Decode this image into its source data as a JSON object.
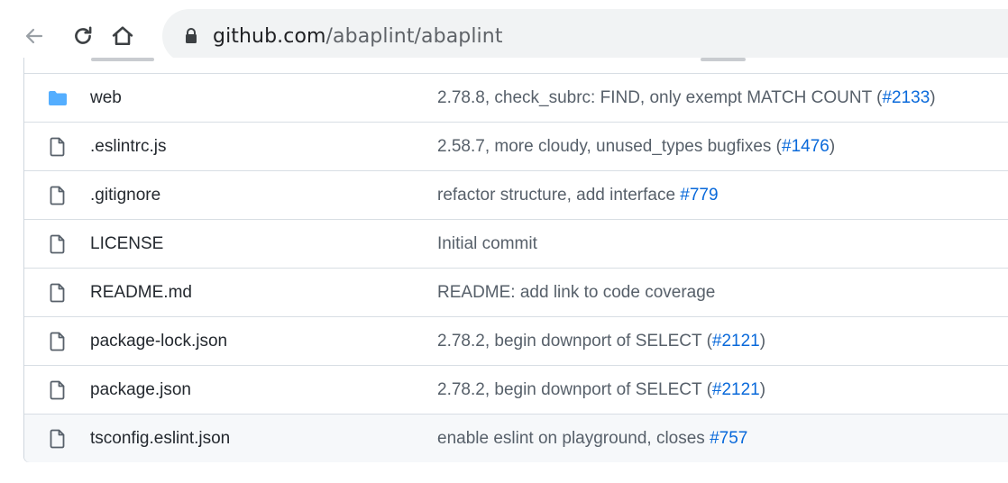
{
  "browser": {
    "url_host": "github.com",
    "url_path": "/abaplint/abaplint",
    "icons": {
      "back": "arrow-left",
      "reload": "reload",
      "home": "home",
      "lock": "lock"
    }
  },
  "files": [
    {
      "name": "web",
      "type": "folder",
      "msg_before": "2.78.8, check_subrc: FIND, only exempt MATCH COUNT (",
      "link": "#2133",
      "msg_after": ")"
    },
    {
      "name": ".eslintrc.js",
      "type": "file",
      "msg_before": "2.58.7, more cloudy, unused_types bugfixes (",
      "link": "#1476",
      "msg_after": ")"
    },
    {
      "name": ".gitignore",
      "type": "file",
      "msg_before": "refactor structure, add interface ",
      "link": "#779",
      "msg_after": ""
    },
    {
      "name": "LICENSE",
      "type": "file",
      "msg_before": "Initial commit",
      "link": "",
      "msg_after": ""
    },
    {
      "name": "README.md",
      "type": "file",
      "msg_before": "README: add link to code coverage",
      "link": "",
      "msg_after": ""
    },
    {
      "name": "package-lock.json",
      "type": "file",
      "msg_before": "2.78.2, begin downport of SELECT (",
      "link": "#2121",
      "msg_after": ")"
    },
    {
      "name": "package.json",
      "type": "file",
      "msg_before": "2.78.2, begin downport of SELECT (",
      "link": "#2121",
      "msg_after": ")"
    },
    {
      "name": "tsconfig.eslint.json",
      "type": "file",
      "msg_before": "enable eslint on playground, closes ",
      "link": "#757",
      "msg_after": ""
    }
  ],
  "colors": {
    "folder": "#54aeff",
    "link": "#0969da"
  }
}
